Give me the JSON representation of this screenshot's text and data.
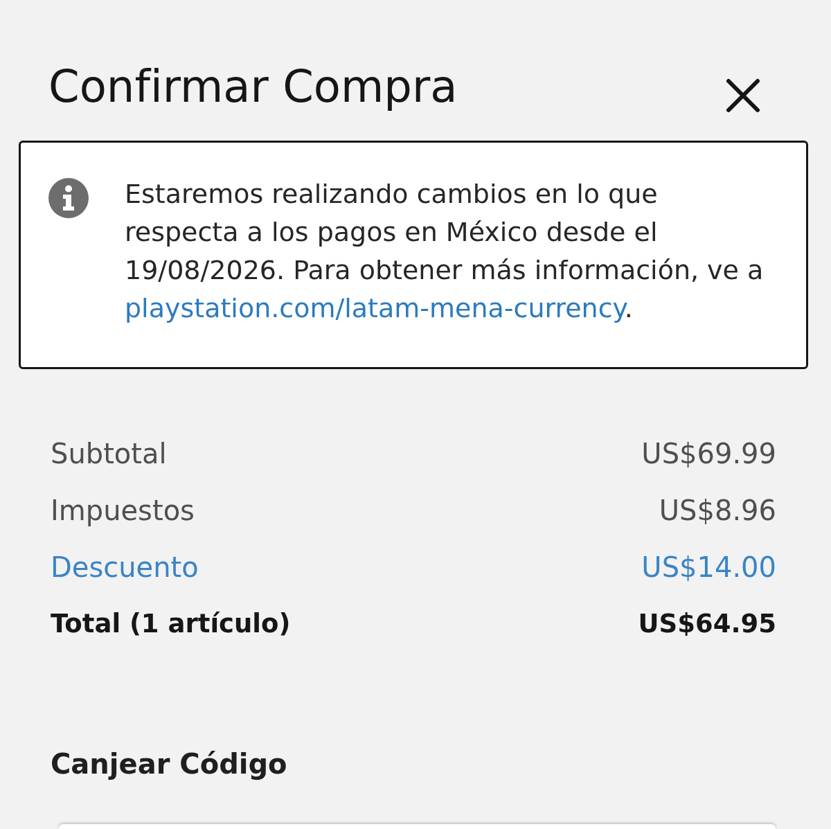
{
  "dialog": {
    "title": "Confirmar Compra"
  },
  "notice": {
    "text": "Estaremos realizando cambios en lo que respecta a los pagos en México desde el 19/08/2026. Para obtener más información, ve a",
    "link": "playstation.com/latam-mena-currency",
    "link_suffix": "."
  },
  "summary": [
    {
      "label": "Subtotal",
      "amount": "US$69.99",
      "kind": "normal"
    },
    {
      "label": "Impuestos",
      "amount": "US$8.96",
      "kind": "normal"
    },
    {
      "label": "Descuento",
      "amount": "US$14.00",
      "kind": "discount"
    },
    {
      "label": "Total (1 artículo)",
      "amount": "US$64.95",
      "kind": "total"
    }
  ],
  "redeem": {
    "title": "Canjear Código"
  }
}
